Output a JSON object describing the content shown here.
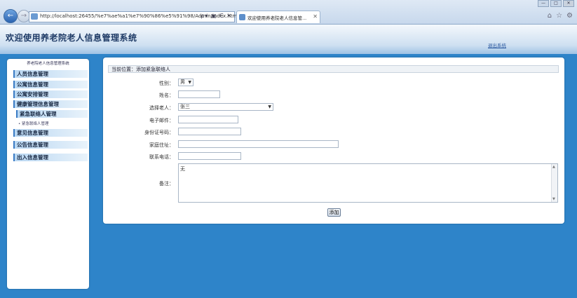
{
  "browser": {
    "address_url": "http://localhost:26455/%e7%ae%a1%e7%90%86%e5%91%98/Admin/index.htm",
    "address_tools": "ρ▾ ▣ C ✕",
    "tab_title": "欢迎使用养老院老人信息管...",
    "window_buttons": [
      "—",
      "□",
      "✕"
    ],
    "toolbar_icons": [
      "⌂",
      "☆",
      "⚙"
    ]
  },
  "header": {
    "title": "欢迎使用养老院老人信息管理系统",
    "exit_label": "退出系统"
  },
  "sidebar": {
    "title": "养老院老人信息管理系统",
    "items": [
      {
        "label": "人员信息管理"
      },
      {
        "label": "公寓信息管理"
      },
      {
        "label": "公寓安排管理"
      },
      {
        "label": "健康管理信息管理"
      },
      {
        "label": "紧急联络人管理"
      },
      {
        "label": "意见信息管理"
      },
      {
        "label": "公告信息管理"
      },
      {
        "label": "出入信息管理"
      }
    ],
    "sub_item": "• 紧急联络人管理"
  },
  "main": {
    "breadcrumb": "当前位置：添加紧急联络人",
    "form": {
      "gender_label": "性别：",
      "gender_value": "男",
      "name_label": "姓名：",
      "elder_label": "选择老人：",
      "elder_value": "张三",
      "email_label": "电子邮件：",
      "idcard_label": "身份证号码：",
      "address_label": "家庭住址：",
      "phone_label": "联系电话：",
      "remark_label": "备注：",
      "remark_value": "无",
      "submit_label": "添加"
    }
  },
  "colors": {
    "background": "#2e84c9",
    "menu_accent": "#3a7bc4",
    "title_text": "#1f3b66"
  }
}
